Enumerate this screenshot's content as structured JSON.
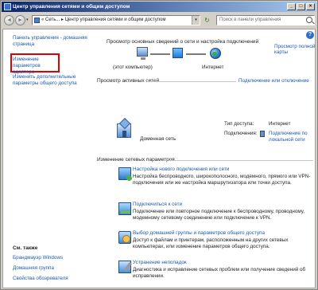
{
  "window": {
    "title": "Центр управления сетями и общим доступом",
    "controls": {
      "minimize": "_",
      "maximize": "□",
      "close": "×"
    }
  },
  "toolbar": {
    "back": "◄",
    "forward": "►",
    "address": "« Сеть... ▸ Центр управления сетями и общим доступом",
    "search_placeholder": "Поиск в панели управления"
  },
  "left_pane": {
    "home_link": "Панель управления - домашняя страница",
    "adapter_link": "Изменение параметров адаптера",
    "sharing_link": "Изменить дополнительные параметры общего доступа",
    "see_also_title": "См. также",
    "see_also": [
      {
        "label": "Брандмауэр Windows"
      },
      {
        "label": "Домашняя группа"
      },
      {
        "label": "Свойства обозревателя"
      }
    ]
  },
  "main": {
    "heading": "Просмотр основных сведений о сети и настройка подключений",
    "full_map_link": "Просмотр полной карты",
    "map": {
      "computer_label": "(этот компьютер)",
      "internet_label": "Интернет"
    },
    "active_networks": {
      "header": "Просмотр активных сетей",
      "connect_disconnect_link": "Подключение или отключение",
      "network_name": "Доменная сеть",
      "access_type_label": "Тип доступа:",
      "access_type_value": "Интернет",
      "connections_label": "Подключения:",
      "connection_value": "Подключение по локальной сети"
    },
    "change_settings": {
      "header": "Изменение сетевых параметров",
      "tasks": [
        {
          "icon": "network-setup-icon",
          "title": "Настройка нового подключения или сети",
          "description": "Настройка беспроводного, широкополосного, модемного, прямого или VPN-подключения или же настройка маршрутизатора или точки доступа."
        },
        {
          "icon": "connect-network-icon",
          "title": "Подключиться к сети",
          "description": "Подключение или повторное подключение к беспроводному, проводному, модемному сетевому соединению или подключение к VPN."
        },
        {
          "icon": "homegroup-icon",
          "title": "Выбор домашней группы и параметров общего доступа",
          "description": "Доступ к файлам и принтерам, расположенным на других сетевых компьютерах, или изменение параметров общего доступа."
        },
        {
          "icon": "troubleshoot-icon",
          "title": "Устранение неполадок",
          "description": "Диагностика и исправление сетевых проблем или получение сведений об исправлении."
        }
      ]
    }
  },
  "colors": {
    "link": "#1a5ab0",
    "highlight_box": "#e00000",
    "title_bar_start": "#0a246a",
    "title_bar_end": "#a6caf0"
  }
}
